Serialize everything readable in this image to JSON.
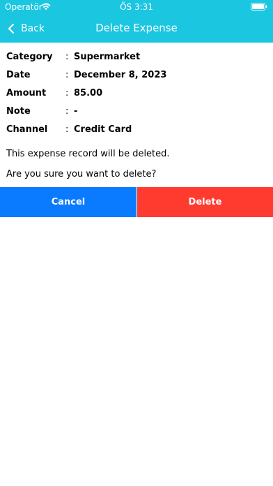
{
  "status_bar": {
    "carrier": "Operatör",
    "time": "ÖS 3:31"
  },
  "nav": {
    "back_label": "Back",
    "title": "Delete Expense"
  },
  "details": [
    {
      "label": "Category",
      "separator": ":",
      "value": "Supermarket"
    },
    {
      "label": "Date",
      "separator": ":",
      "value": "December 8, 2023"
    },
    {
      "label": "Amount",
      "separator": ":",
      "value": "85.00"
    },
    {
      "label": "Note",
      "separator": ":",
      "value": "-"
    },
    {
      "label": "Channel",
      "separator": ":",
      "value": "Credit Card"
    }
  ],
  "messages": {
    "warning": "This expense record will be deleted.",
    "confirm": "Are you sure you want to delete?"
  },
  "buttons": {
    "cancel": "Cancel",
    "delete": "Delete"
  },
  "colors": {
    "header": "#1bc6e1",
    "cancel": "#0a7aff",
    "delete": "#ff3b30"
  },
  "icons": {
    "wifi": "wifi-icon",
    "battery": "battery-icon",
    "back": "chevron-left-icon"
  }
}
